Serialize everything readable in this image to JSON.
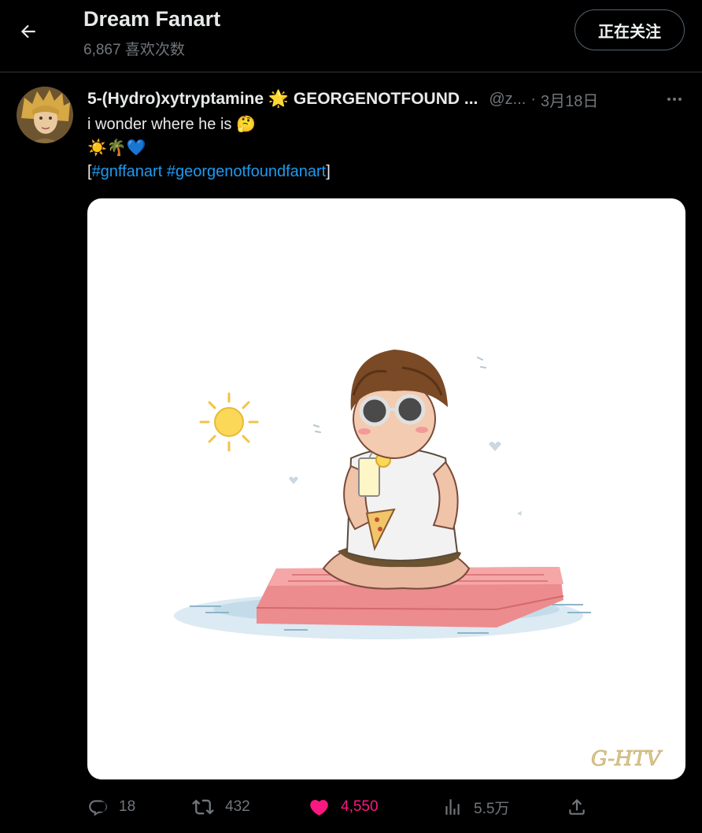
{
  "header": {
    "title": "Dream Fanart",
    "subtitle": "6,867 喜欢次数",
    "follow_label": "正在关注"
  },
  "tweet": {
    "author_name": "5-(Hydro)xytryptamine 🌟 GEORGENOTFOUND ...",
    "handle": "@z...",
    "separator": "·",
    "date": "3月18日",
    "text_line1": "i wonder where he is 🤔",
    "text_line2": "☀️🌴💙",
    "text_line3_open": "[",
    "hashtag1": "#gnffanart",
    "hashtag2": "#georgenotfoundfanart",
    "text_line3_close": " ]",
    "media_signature": "G-HTV",
    "actions": {
      "replies": "18",
      "retweets": "432",
      "likes": "4,550",
      "views": "5.5万"
    }
  },
  "colors": {
    "background": "#000000",
    "text": "#e7e9ea",
    "muted": "#71767b",
    "link": "#1d9bf0",
    "like": "#f91880",
    "divider": "#2f3336"
  },
  "icons": {
    "back": "arrow-left-icon",
    "more": "more-horizontal-icon",
    "reply": "reply-icon",
    "retweet": "retweet-icon",
    "like": "heart-filled-icon",
    "views": "views-icon",
    "share": "share-icon"
  }
}
